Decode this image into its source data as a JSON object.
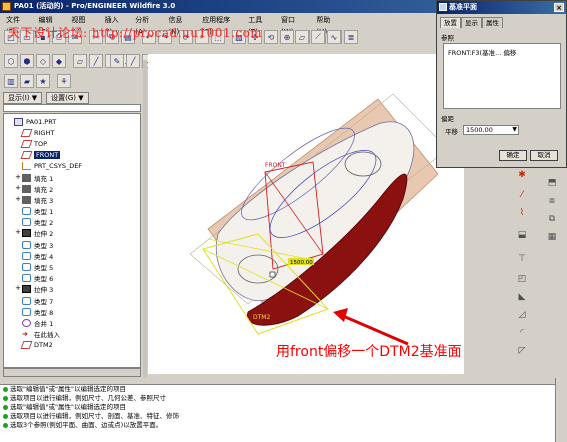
{
  "window": {
    "title": "PA01 (活动的) - Pro/ENGINEER Wildfire 3.0"
  },
  "menubar": [
    "文件(F)",
    "编辑(E)",
    "视图(V)",
    "插入(I)",
    "分析(A)",
    "信息(N)",
    "应用程序(P)",
    "工具(T)",
    "窗口(W)",
    "帮助(H)"
  ],
  "watermark": {
    "text": "天下设计论坛: http://procad.uu1001.com"
  },
  "panel": {
    "show_label": "显示(I) ▼",
    "settings_label": "设置(G) ▼"
  },
  "tree": [
    {
      "label": "PA01.PRT",
      "icon": "part-icon",
      "indent": 0,
      "expander": ""
    },
    {
      "label": "RIGHT",
      "icon": "datum-plane-icon",
      "indent": 1,
      "expander": ""
    },
    {
      "label": "TOP",
      "icon": "datum-plane-icon",
      "indent": 1,
      "expander": ""
    },
    {
      "label": "FRONT",
      "icon": "datum-plane-icon",
      "indent": 1,
      "expander": "",
      "selected": true
    },
    {
      "label": "PRT_CSYS_DEF",
      "icon": "csys-icon",
      "indent": 1,
      "expander": ""
    },
    {
      "label": "填充 1",
      "icon": "fill-icon",
      "indent": 1,
      "expander": "+"
    },
    {
      "label": "填充 2",
      "icon": "fill-icon",
      "indent": 1,
      "expander": "+"
    },
    {
      "label": "填充 3",
      "icon": "fill-icon",
      "indent": 1,
      "expander": "+"
    },
    {
      "label": "类型 1",
      "icon": "style-icon",
      "indent": 1,
      "expander": ""
    },
    {
      "label": "类型 2",
      "icon": "style-icon",
      "indent": 1,
      "expander": ""
    },
    {
      "label": "拉伸 2",
      "icon": "extrude-icon",
      "indent": 1,
      "expander": "+"
    },
    {
      "label": "类型 3",
      "icon": "style-icon",
      "indent": 1,
      "expander": ""
    },
    {
      "label": "类型 4",
      "icon": "style-icon",
      "indent": 1,
      "expander": ""
    },
    {
      "label": "类型 5",
      "icon": "style-icon",
      "indent": 1,
      "expander": ""
    },
    {
      "label": "类型 6",
      "icon": "style-icon",
      "indent": 1,
      "expander": ""
    },
    {
      "label": "拉伸 3",
      "icon": "extrude-icon",
      "indent": 1,
      "expander": "+"
    },
    {
      "label": "类型 7",
      "icon": "style-icon",
      "indent": 1,
      "expander": ""
    },
    {
      "label": "类型 8",
      "icon": "style-icon",
      "indent": 1,
      "expander": ""
    },
    {
      "label": "合并 1",
      "icon": "merge-icon",
      "indent": 1,
      "expander": ""
    },
    {
      "label": "在此插入",
      "icon": "insert-arrow-icon",
      "indent": 1,
      "expander": ""
    },
    {
      "label": "DTM2",
      "icon": "datum-plane-icon",
      "indent": 1,
      "expander": ""
    }
  ],
  "viewport": {
    "labels": {
      "front": "FRONT",
      "dtm2": "DTM2",
      "offset": "1500.00"
    },
    "annotation": "用front偏移一个DTM2基准面",
    "colors": {
      "surface": "#8b1010",
      "plane": "#e8c8b0",
      "datum_line": "#d02020",
      "preview": "#e0e020"
    }
  },
  "dialog": {
    "title": "基准平面",
    "tabs": [
      "放置",
      "显示",
      "属性"
    ],
    "ref_label": "参照",
    "ref_item": "FRONT:F3(基准... 偏移",
    "offset_label": "偏距",
    "translate_label": "平移",
    "translate_value": "1500.00",
    "ok_label": "确定",
    "cancel_label": "取消"
  },
  "messages": [
    "选取\"编辑值\"或\"属性\"以编辑选定的项目",
    "选取项目以进行编辑，例如尺寸、几何公差、参照尺寸",
    "选取\"编辑值\"或\"属性\"以编辑选定的项目",
    "选取项目以进行编辑，例如尺寸、剖面、基准、特征、修饰",
    "选取3个参照(例如平面、曲面、边或点)以放置平面。"
  ]
}
